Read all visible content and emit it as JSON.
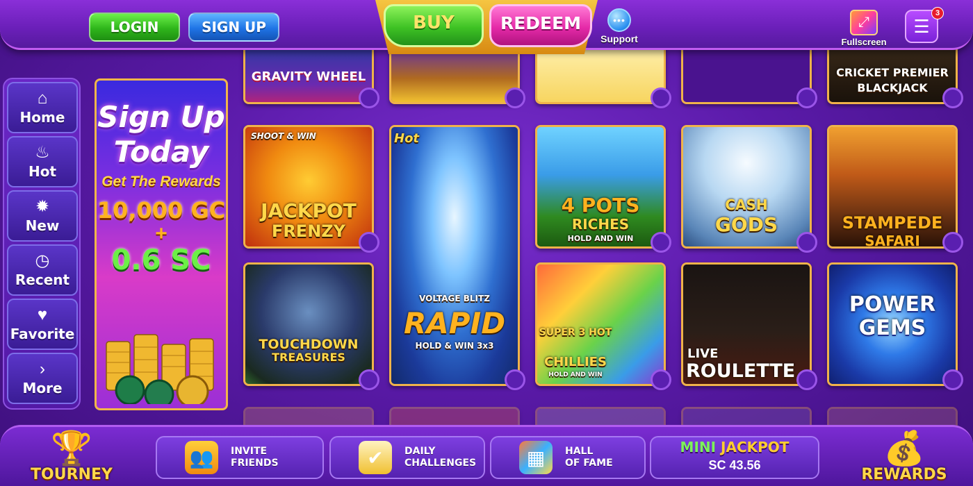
{
  "header": {
    "login_label": "LOGIN",
    "signup_label": "SIGN UP",
    "buy_label": "BUY",
    "redeem_label": "REDEEM",
    "support_label": "Support",
    "fullscreen_label": "Fullscreen",
    "menu_badge_count": "3"
  },
  "sidebar": {
    "items": [
      {
        "label": "Home",
        "icon": "home-icon"
      },
      {
        "label": "Hot",
        "icon": "flame-icon"
      },
      {
        "label": "New",
        "icon": "new-badge-icon"
      },
      {
        "label": "Recent",
        "icon": "clock-icon"
      },
      {
        "label": "Favorite",
        "icon": "heart-icon"
      },
      {
        "label": "More",
        "icon": "chevron-right-icon"
      }
    ]
  },
  "promo": {
    "title_line1": "Sign Up",
    "title_line2": "Today",
    "subtitle": "Get The Rewards",
    "gc_amount": "10,000 GC",
    "plus": "+",
    "sc_amount": "0.6 SC"
  },
  "games": {
    "top_row": [
      {
        "title": "GRAVITY WHEEL"
      },
      {
        "title": ""
      },
      {
        "title": ""
      },
      {
        "title": ""
      },
      {
        "title": "CRICKET PREMIER BLACKJACK"
      }
    ],
    "jackpot_frenzy": {
      "tag": "SHOOT & WIN",
      "title1": "JACKPOT",
      "title2": "FRENZY"
    },
    "rapid": {
      "hot_tag": "Hot",
      "brand": "VOLTAGE BLITZ",
      "title": "RAPID",
      "sub": "HOLD & WIN 3x3"
    },
    "four_pots": {
      "title1": "4 POTS",
      "title2": "RICHES",
      "sub": "HOLD AND WIN"
    },
    "cash_gods": {
      "title1": "CASH",
      "title2": "GODS"
    },
    "stampede": {
      "title1": "STAMPEDE",
      "title2": "SAFARI"
    },
    "touchdown": {
      "title1": "TOUCHDOWN",
      "title2": "TREASURES"
    },
    "hot_chillies": {
      "title1": "SUPER 3 HOT",
      "title2": "CHILLIES",
      "sub": "HOLD AND WIN"
    },
    "roulette": {
      "title1": "LIVE",
      "title2": "ROULETTE"
    },
    "power_gems": {
      "title1": "POWER",
      "title2": "GEMS"
    }
  },
  "bottom": {
    "tourney_label": "TOURNEY",
    "invite_line1": "INVITE",
    "invite_line2": "FRIENDS",
    "daily_line1": "DAILY",
    "daily_line2": "CHALLENGES",
    "hall_line1": "HALL",
    "hall_line2": "OF FAME",
    "jackpot_mini": "MINI",
    "jackpot_word": "JACKPOT",
    "jackpot_value": "SC 43.56",
    "rewards_label": "REWARDS"
  },
  "colors": {
    "background": "#5a1aa8",
    "tile_border": "#f0b34a",
    "buy_green": "#3ec224",
    "redeem_pink": "#e52aa8"
  }
}
